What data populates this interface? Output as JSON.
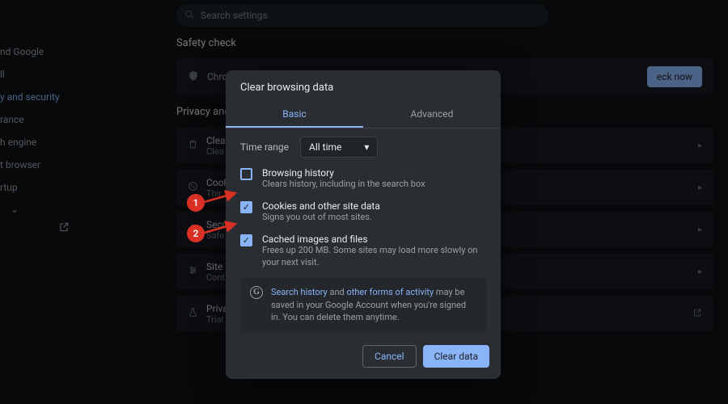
{
  "search": {
    "placeholder": "Search settings"
  },
  "sidebar": {
    "items": [
      {
        "label": "nd Google"
      },
      {
        "label": "ll"
      },
      {
        "label": "y and security"
      },
      {
        "label": "rance"
      },
      {
        "label": "h engine"
      },
      {
        "label": "t browser"
      },
      {
        "label": "rtup"
      }
    ]
  },
  "sections": {
    "safety_title": "Safety check",
    "safety_row": {
      "label": "Chro",
      "button": "eck now"
    },
    "privacy_title": "Privacy and s",
    "rows": [
      {
        "t1": "Clear",
        "t2": "Clea"
      },
      {
        "t1": "Cook",
        "t2": "Thir"
      },
      {
        "t1": "Secu",
        "t2": "Safe"
      },
      {
        "t1": "Site",
        "t2": "Cont"
      },
      {
        "t1": "Priva",
        "t2": "Trial"
      }
    ]
  },
  "dialog": {
    "title": "Clear browsing data",
    "tabs": {
      "basic": "Basic",
      "advanced": "Advanced"
    },
    "time_label": "Time range",
    "time_value": "All time",
    "options": [
      {
        "title": "Browsing history",
        "sub": "Clears history, including in the search box",
        "checked": false
      },
      {
        "title": "Cookies and other site data",
        "sub": "Signs you out of most sites.",
        "checked": true
      },
      {
        "title": "Cached images and files",
        "sub": "Frees up 200 MB. Some sites may load more slowly on your next visit.",
        "checked": true
      }
    ],
    "note": {
      "link1": "Search history",
      "mid1": " and ",
      "link2": "other forms of activity",
      "rest": " may be saved in your Google Account when you're signed in. You can delete them anytime."
    },
    "cancel": "Cancel",
    "clear": "Clear data"
  },
  "annotations": {
    "a1": "1",
    "a2": "2"
  }
}
